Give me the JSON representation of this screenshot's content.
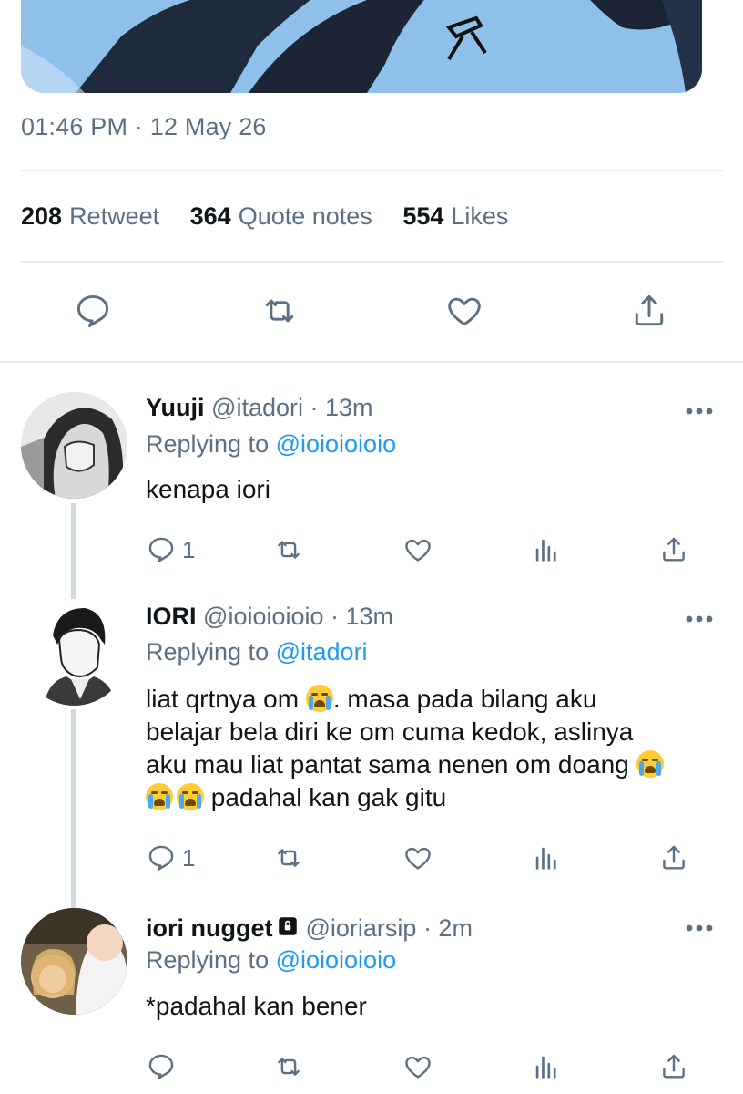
{
  "tweet": {
    "timestamp": "01:46 PM · 12 May 26",
    "stats": [
      {
        "count": "208",
        "label": "Retweet"
      },
      {
        "count": "364",
        "label": "Quote notes"
      },
      {
        "count": "554",
        "label": "Likes"
      }
    ],
    "actions": [
      "reply-icon",
      "retweet-icon",
      "like-icon",
      "share-icon"
    ]
  },
  "replies": [
    {
      "name": "Yuuji",
      "handle": "@itadori",
      "time": "· 13m",
      "replying_prefix": "Replying to",
      "replying_to": "@ioioioioio",
      "text": [
        "kenapa iori"
      ],
      "reply_count": "1",
      "locked": false
    },
    {
      "name": "IORI",
      "handle": "@ioioioioio",
      "time": "· 13m",
      "replying_prefix": "Replying to",
      "replying_to": "@itadori",
      "text_parts": {
        "l1a": "liat qrtnya om ",
        "l1b": ". masa pada bilang aku",
        "l2": "belajar bela diri ke om cuma kedok, aslinya",
        "l3": "aku mau liat pantat sama nenen om doang ",
        "l4": " padahal kan gak gitu"
      },
      "reply_count": "1",
      "locked": false
    },
    {
      "name": "iori nugget",
      "handle": "@ioriarsip",
      "time": "· 2m",
      "replying_prefix": "Replying to",
      "replying_to": "@ioioioioio",
      "text": [
        "*padahal kan bener"
      ],
      "reply_count": "",
      "locked": true
    }
  ],
  "colors": {
    "accent": "#1d9bf0",
    "secondary_text": "#5b7083",
    "divider": "#e6ecf0",
    "thread_line": "#cfd9de"
  }
}
